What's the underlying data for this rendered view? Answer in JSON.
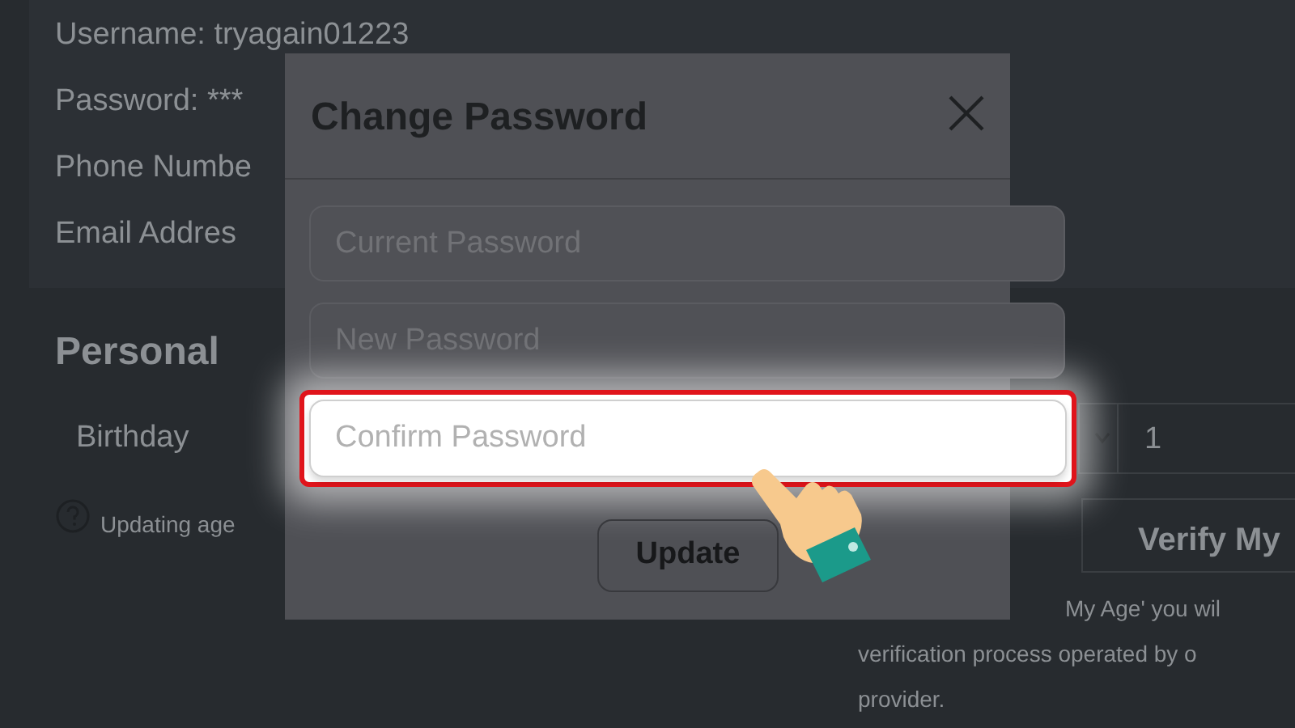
{
  "account": {
    "lines": [
      "Username: tryagain01223",
      "Password: ***",
      "Phone Numbe",
      "Email Addres"
    ]
  },
  "personal": {
    "heading": "Personal",
    "birthday_label": "Birthday",
    "day_value": "1",
    "help_text": "Updating age",
    "verify_button": "Verify My",
    "verify_note": [
      "My Age' you wil",
      "verification process operated by o",
      "provider."
    ]
  },
  "modal": {
    "title": "Change Password",
    "fields": [
      {
        "placeholder": "Current Password",
        "highlighted": false
      },
      {
        "placeholder": "New Password",
        "highlighted": false
      },
      {
        "placeholder": "Confirm Password",
        "highlighted": true
      }
    ],
    "submit": "Update"
  }
}
